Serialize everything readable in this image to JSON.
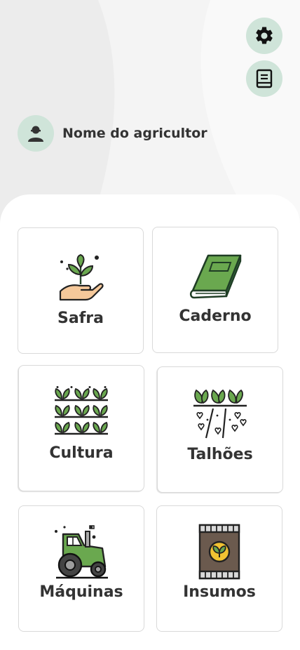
{
  "header": {
    "settings_icon": "gear-icon",
    "notebook_icon": "notebook-icon",
    "farmer_name": "Nome do agricultor",
    "avatar_icon": "person-icon"
  },
  "menu": {
    "items": [
      {
        "label": "Safra",
        "icon": "hand-seedling-icon"
      },
      {
        "label": "Caderno",
        "icon": "green-book-icon"
      },
      {
        "label": "Cultura",
        "icon": "crop-rows-icon"
      },
      {
        "label": "Talhões",
        "icon": "field-plot-icon"
      },
      {
        "label": "Máquinas",
        "icon": "tractor-icon"
      },
      {
        "label": "Insumos",
        "icon": "seed-bag-icon"
      }
    ]
  },
  "colors": {
    "accent_bg": "#cfe4d9",
    "plant_green": "#6aa84f",
    "dark_green": "#2e6b3f",
    "text": "#333333"
  }
}
